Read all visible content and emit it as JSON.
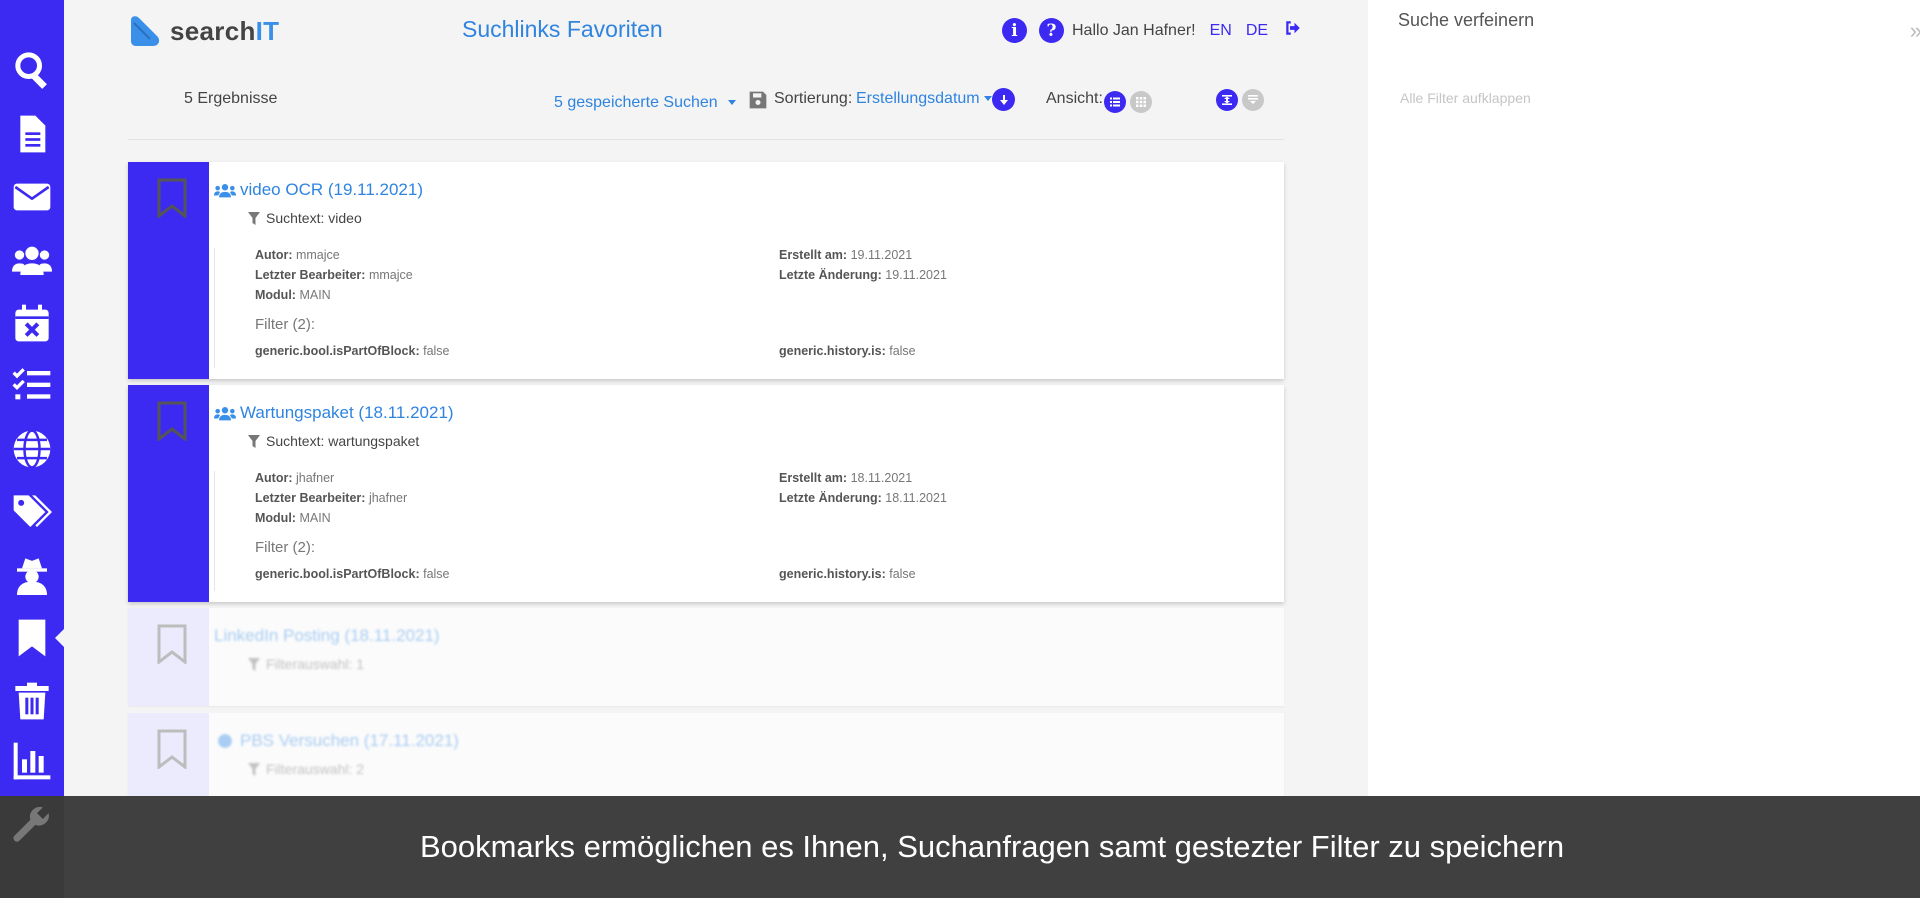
{
  "app": {
    "logo_main": "search",
    "logo_accent": "IT",
    "page_title": "Suchlinks Favoriten"
  },
  "header": {
    "info_icon": "i",
    "help_icon": "?",
    "greeting": "Hallo Jan Hafner!",
    "lang_en": "EN",
    "lang_de": "DE"
  },
  "toolbar": {
    "results": "5 Ergebnisse",
    "saved_searches": "5 gespeicherte Suchen",
    "sort_label": "Sortierung:",
    "sort_value": "Erstellungsdatum",
    "view_label": "Ansicht:"
  },
  "cards": [
    {
      "title": "video OCR (19.11.2021)",
      "subtitle": "Suchtext: video",
      "author_label": "Autor:",
      "author": "mmajce",
      "editor_label": "Letzter Bearbeiter:",
      "editor": "mmajce",
      "module_label": "Modul:",
      "module": "MAIN",
      "created_label": "Erstellt am:",
      "created": "19.11.2021",
      "changed_label": "Letzte Änderung:",
      "changed": "19.11.2021",
      "filter_header": "Filter (2):",
      "filters": [
        {
          "label": "generic.bool.isPartOfBlock:",
          "value": "false"
        },
        {
          "label": "generic.history.is:",
          "value": "false"
        }
      ]
    },
    {
      "title": "Wartungspaket (18.11.2021)",
      "subtitle": "Suchtext: wartungspaket",
      "author_label": "Autor:",
      "author": "jhafner",
      "editor_label": "Letzter Bearbeiter:",
      "editor": "jhafner",
      "module_label": "Modul:",
      "module": "MAIN",
      "created_label": "Erstellt am:",
      "created": "18.11.2021",
      "changed_label": "Letzte Änderung:",
      "changed": "18.11.2021",
      "filter_header": "Filter (2):",
      "filters": [
        {
          "label": "generic.bool.isPartOfBlock:",
          "value": "false"
        },
        {
          "label": "generic.history.is:",
          "value": "false"
        }
      ]
    },
    {
      "title": "LinkedIn Posting (18.11.2021)",
      "subtitle": "Filterauswahl: 1"
    },
    {
      "title": "PBS Versuchen (17.11.2021)",
      "subtitle": "Filterauswahl: 2"
    }
  ],
  "panel": {
    "title": "Suche verfeinern",
    "expand_all": "Alle Filter aufklappen"
  },
  "caption": "Bookmarks ermöglichen es Ihnen, Suchanfragen samt gestezter Filter zu speichern",
  "colors": {
    "accent": "#3d2af2",
    "link": "#2f84e0",
    "caption_bg": "#3a3a3a"
  }
}
